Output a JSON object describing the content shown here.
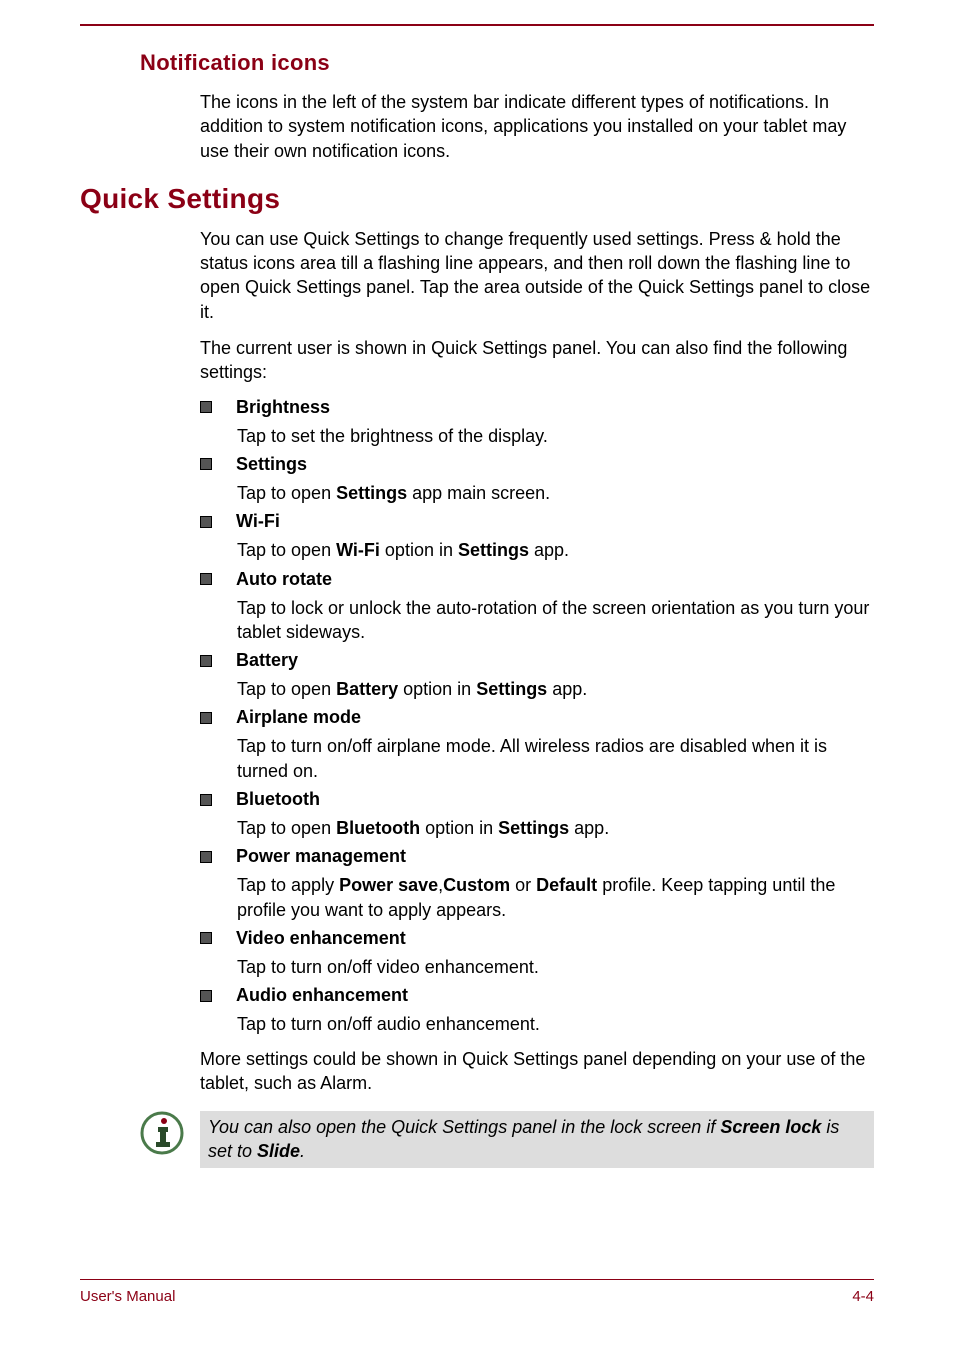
{
  "headings": {
    "notification_icons": "Notification icons",
    "quick_settings": "Quick Settings"
  },
  "notification_para": "The icons in the left of the system bar indicate different types of notifications. In addition to system notification icons, applications you installed on your tablet may use their own notification icons.",
  "qs_para1": "You can use Quick Settings to change frequently used settings. Press & hold the status icons area till a flashing line appears, and then roll down the flashing line to open Quick Settings panel. Tap the area outside of the Quick Settings panel to close it.",
  "qs_para2": "The current user is shown in Quick Settings panel. You can also find the following settings:",
  "settings": {
    "brightness": {
      "title": "Brightness",
      "desc_plain": "Tap to set the brightness of the display."
    },
    "settings": {
      "title": "Settings",
      "p1": "Tap to open ",
      "b1": "Settings",
      "p2": " app main screen."
    },
    "wifi": {
      "title": "Wi-Fi",
      "p1": "Tap to open ",
      "b1": "Wi-Fi",
      "p2": " option in ",
      "b2": "Settings",
      "p3": " app."
    },
    "autorotate": {
      "title": "Auto rotate",
      "desc_plain": "Tap to lock or unlock the auto-rotation of the screen orientation as you turn your tablet sideways."
    },
    "battery": {
      "title": "Battery",
      "p1": "Tap to open ",
      "b1": "Battery",
      "p2": " option in ",
      "b2": "Settings",
      "p3": " app."
    },
    "airplane": {
      "title": "Airplane mode",
      "desc_plain": "Tap to turn on/off airplane mode. All wireless radios are disabled when it is turned on."
    },
    "bluetooth": {
      "title": "Bluetooth",
      "p1": "Tap to open ",
      "b1": "Bluetooth",
      "p2": " option in ",
      "b2": "Settings",
      "p3": " app."
    },
    "power": {
      "title": "Power management",
      "p1": "Tap to apply ",
      "b1": "Power save",
      "p2": ",",
      "b2": "Custom",
      "p3": " or ",
      "b3": "Default",
      "p4": " profile. Keep tapping until the profile you want to apply appears."
    },
    "video": {
      "title": "Video enhancement",
      "desc_plain": "Tap to turn on/off video enhancement."
    },
    "audio": {
      "title": "Audio enhancement",
      "desc_plain": "Tap to turn on/off audio enhancement."
    }
  },
  "qs_para3": "More settings could be shown in Quick Settings panel depending on your use of the tablet, such as Alarm.",
  "note": {
    "p1": "You can also open the Quick Settings panel in the lock screen if ",
    "b1": "Screen lock",
    "p2": " is set to ",
    "b2": "Slide",
    "p3": "."
  },
  "footer": {
    "left": "User's Manual",
    "right": "4-4"
  }
}
